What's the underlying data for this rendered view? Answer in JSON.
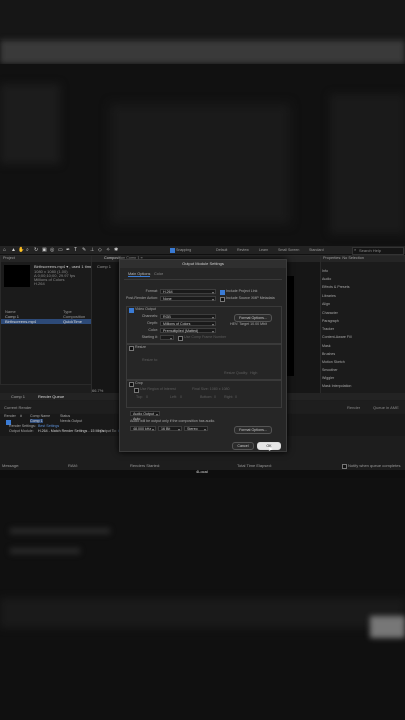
{
  "toolbar": {
    "snapping_label": "Snapping",
    "workspaces": [
      "Default",
      "Review",
      "Learn",
      "Small Screen",
      "Standard"
    ],
    "search_placeholder": "Search Help"
  },
  "project_panel": {
    "tab": "Project",
    "comp_name": "Birthscreens.mp4 ▾ , used 1 time",
    "comp_info": [
      "1080 x 1080 (1.00)",
      "Δ 0;00;10;00, 29.97 fps",
      "Millions of Colors",
      "H.264"
    ],
    "column_name": "Name",
    "column_type": "Type",
    "items": [
      {
        "name": "Comp 1",
        "type": "Composition"
      },
      {
        "name": "Birthscreens.mp4",
        "type": "QuickTime"
      }
    ]
  },
  "composition_panel": {
    "tab": "Composition Comp 1 ≡",
    "sub_tab": "Comp 1",
    "zoom": "66.7%"
  },
  "right_panel": {
    "title": "Properties: No Selection",
    "items": [
      "Info",
      "Audio",
      "Effects & Presets",
      "Libraries",
      "Align",
      "Character",
      "Paragraph",
      "Tracker",
      "Content-Aware Fill",
      "Mask",
      "Brushes",
      "Motion Sketch",
      "Smoother",
      "Wiggler",
      "Mask Interpolation"
    ]
  },
  "dialog": {
    "title": "Output Module Settings",
    "tabs": [
      "Main Options",
      "Color"
    ],
    "format_label": "Format:",
    "format_value": "H.264",
    "include_project_link": "Include Project Link",
    "post_render_label": "Post-Render Action:",
    "post_render_value": "None",
    "include_xmp": "Include Source XMP Metadata",
    "video_output": "Video Output",
    "channels_label": "Channels:",
    "channels_value": "RGB",
    "format_options_btn": "Format Options...",
    "depth_label": "Depth:",
    "depth_value": "Millions of Colors",
    "codec_info": "HEV: Target 10.00 Mbit",
    "color_label": "Color:",
    "color_value": "Premultiplied (Matted)",
    "starting_label": "Starting #:",
    "starting_value": "",
    "use_comp_frame": "Use Comp Frame Number",
    "resize": "Resize",
    "resize_to_label": "Resize to:",
    "resize_quality_label": "Resize Quality:",
    "resize_quality_value": "High",
    "crop": "Crop",
    "use_roi": "Use Region of Interest",
    "final_size_label": "Final Size: 1080 x 1080",
    "top_label": "Top:",
    "left_label": "Left:",
    "bottom_label": "Bottom:",
    "right_label": "Right:",
    "crop_top": "0",
    "crop_left": "0",
    "crop_bottom": "0",
    "crop_right": "0",
    "audio_output_label": "Audio Output Auto",
    "audio_note": "Audio will be output only if the composition has audio.",
    "audio_rate": "48.000 kHz",
    "audio_bits": "16 Bit",
    "audio_channels": "Stereo",
    "audio_format_options": "Format Options...",
    "cancel": "Cancel",
    "ok": "OK"
  },
  "bottom_tabs": {
    "tab1": "Comp 1",
    "tab2": "Render Queue",
    "current_render": "Current Render",
    "render_btn": "Render",
    "queue_ame_btn": "Queue in AME"
  },
  "render_queue": {
    "headers": [
      "Render",
      "#",
      "Comp Name",
      "Status"
    ],
    "row_comp": "Comp 1",
    "row_status": "Needs Output",
    "render_settings_label": "Render Settings:",
    "render_settings_value": "Best Settings",
    "output_module_label": "Output Module:",
    "output_module_value": "H.264 - Match Render Settings - 15 Mbps",
    "output_to_label": "Output To:",
    "output_to_value": "Comp 1.mp4"
  },
  "status_bar": {
    "message": "Message:",
    "ram": "RAM:",
    "renders_started": "Renders Started:",
    "total_time": "Total Time Elapsed:",
    "notify": "Notify when queue completes",
    "cursor_label": "4Local"
  }
}
